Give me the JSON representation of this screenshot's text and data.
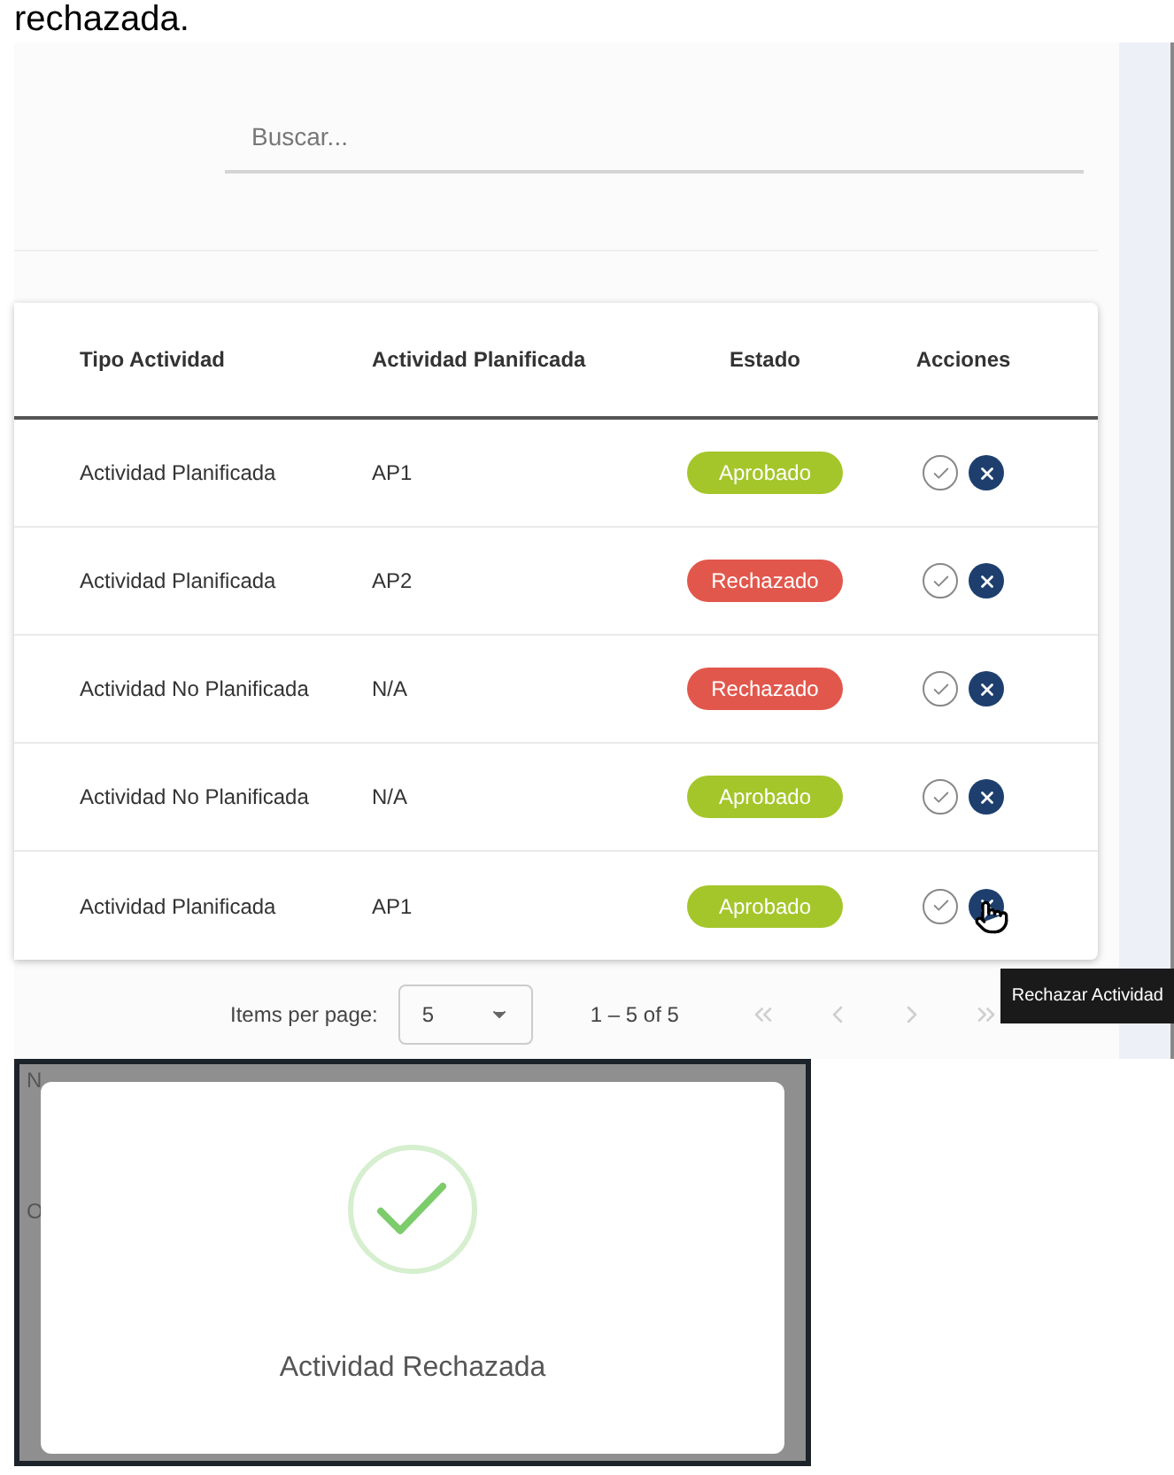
{
  "document_text": "rechazada.",
  "search": {
    "placeholder": "Buscar..."
  },
  "table": {
    "columns": [
      "Tipo Actividad",
      "Actividad Planificada",
      "Estado",
      "Acciones"
    ],
    "rows": [
      {
        "tipo": "Actividad Planificada",
        "planificada": "AP1",
        "estado": {
          "label": "Aprobado",
          "kind": "approved"
        },
        "hovered": false
      },
      {
        "tipo": "Actividad Planificada",
        "planificada": "AP2",
        "estado": {
          "label": "Rechazado",
          "kind": "rejected"
        },
        "hovered": false
      },
      {
        "tipo": "Actividad No Planificada",
        "planificada": "N/A",
        "estado": {
          "label": "Rechazado",
          "kind": "rejected"
        },
        "hovered": false
      },
      {
        "tipo": "Actividad No Planificada",
        "planificada": "N/A",
        "estado": {
          "label": "Aprobado",
          "kind": "approved"
        },
        "hovered": false
      },
      {
        "tipo": "Actividad Planificada",
        "planificada": "AP1",
        "estado": {
          "label": "Aprobado",
          "kind": "approved"
        },
        "hovered": true
      }
    ]
  },
  "tooltip": "Rechazar Actividad",
  "pagination": {
    "label": "Items per page:",
    "page_size": "5",
    "range": "1 – 5 of 5",
    "buttons": [
      {
        "kind": "first",
        "disabled": true
      },
      {
        "kind": "previous",
        "disabled": true
      },
      {
        "kind": "next",
        "disabled": true
      },
      {
        "kind": "last",
        "disabled": true
      }
    ]
  },
  "dialog": {
    "background_texts": [
      "N",
      "O"
    ],
    "message": "Actividad Rechazada"
  }
}
